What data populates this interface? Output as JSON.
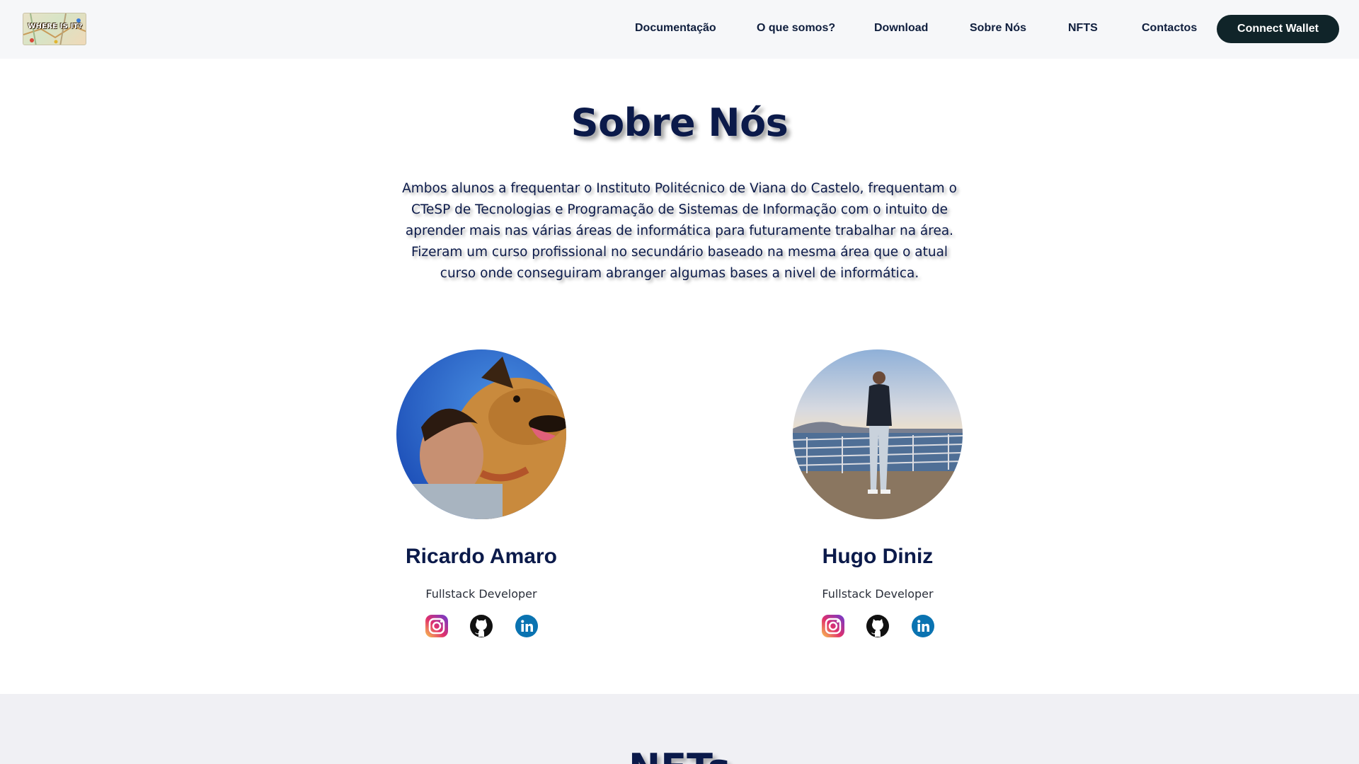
{
  "navbar": {
    "logo_text": "WHERE IS IT?",
    "links": [
      "Documentação",
      "O que somos?",
      "Download",
      "Sobre Nós",
      "NFTS",
      "Contactos"
    ],
    "connect_label": "Connect Wallet"
  },
  "about": {
    "title": "Sobre Nós",
    "description": "Ambos alunos a frequentar o Instituto Politécnico de Viana do Castelo, frequentam o CTeSP de Tecnologias e Programação de Sistemas de Informação com o intuito de aprender mais nas várias áreas de informática para futuramente trabalhar na área. Fizeram um curso profissional no secundário baseado na mesma área que o atual curso onde conseguiram abranger algumas bases a nivel de informática.",
    "members": [
      {
        "name": "Ricardo Amaro",
        "role": "Fullstack Developer",
        "socials": [
          "instagram-icon",
          "github-icon",
          "linkedin-icon"
        ]
      },
      {
        "name": "Hugo Diniz",
        "role": "Fullstack Developer",
        "socials": [
          "instagram-icon",
          "github-icon",
          "linkedin-icon"
        ]
      }
    ]
  },
  "nfts": {
    "title": "NFTs"
  },
  "colors": {
    "navy": "#0b1a4a",
    "button": "#102429",
    "navbar_bg": "#f6f7f9",
    "section_bg": "#f0f0f4"
  }
}
